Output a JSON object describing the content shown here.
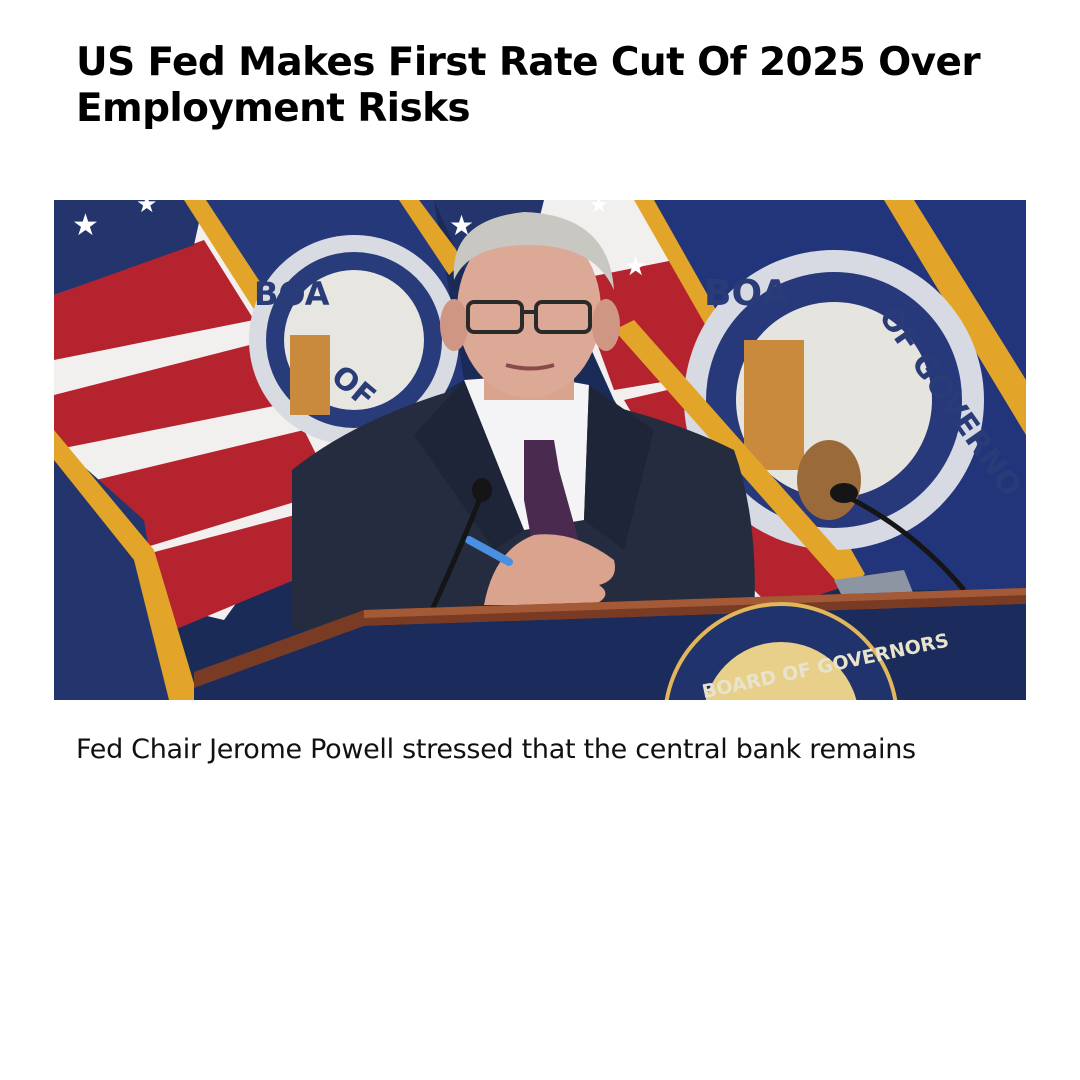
{
  "article": {
    "headline": "US Fed Makes First Rate Cut Of 2025 Over Employment Risks",
    "caption": "Fed Chair Jerome Powell stressed that the central bank remains"
  },
  "photo": {
    "seal_text_left": "BOA",
    "seal_text_left_2": "OF GO",
    "seal_text_right": "BOA",
    "seal_text_right_2": "OF GOVERNO",
    "podium_seal_text": "BOARD OF GOVERNORS"
  },
  "colors": {
    "flag_red": "#b5232f",
    "flag_white": "#f2f0ee",
    "navy": "#1f3466",
    "gold_fringe": "#e2a52a",
    "podium_wood": "#7a3b24",
    "podium_navy": "#1b2c5c",
    "suit": "#252c3f",
    "tie": "#4a2a4e"
  }
}
